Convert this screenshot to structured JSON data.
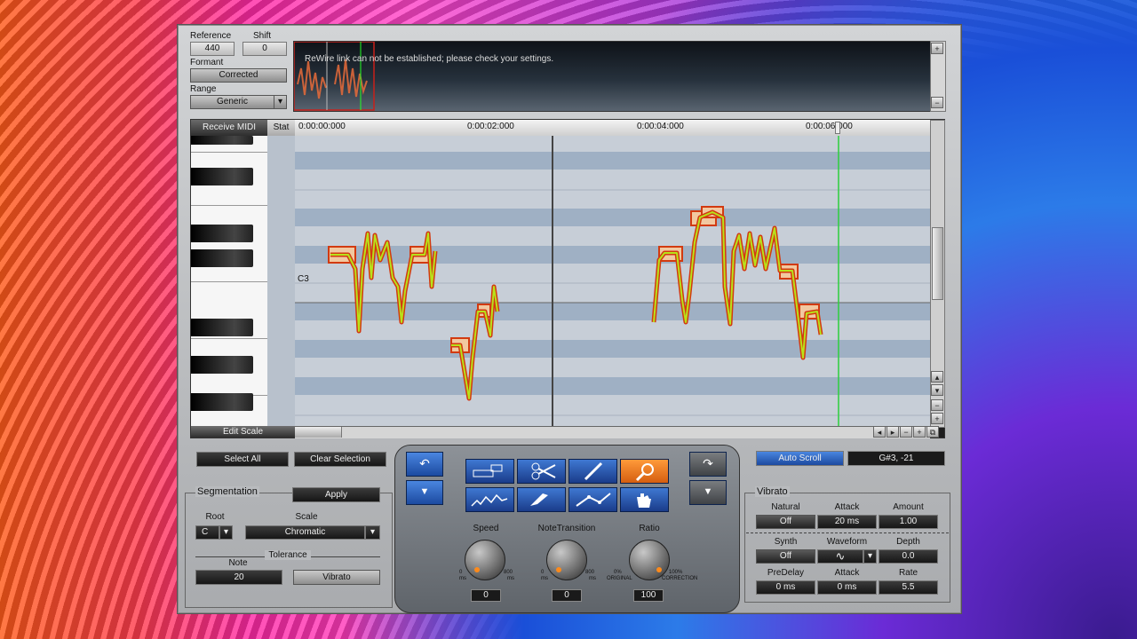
{
  "top": {
    "reference_label": "Reference",
    "reference_value": "440",
    "shift_label": "Shift",
    "shift_value": "0",
    "formant_label": "Formant",
    "formant_value": "Corrected",
    "range_label": "Range",
    "range_value": "Generic",
    "rewire_message": "ReWire link can not be established; please check your settings."
  },
  "editor": {
    "receive_midi": "Receive MIDI",
    "stat": "Stat",
    "edit_scale": "Edit Scale",
    "note_label": "C3",
    "time_marks": [
      "0:00:00:000",
      "0:00:02:000",
      "0:00:04:000",
      "0:00:06:000"
    ]
  },
  "actions": {
    "select_all": "Select All",
    "clear_selection": "Clear Selection",
    "auto_scroll": "Auto Scroll",
    "pitch_readout": "G#3, -21"
  },
  "segmentation": {
    "title": "Segmentation",
    "apply": "Apply",
    "root_label": "Root",
    "root_value": "C",
    "scale_label": "Scale",
    "scale_value": "Chromatic",
    "tolerance_label": "Tolerance",
    "note_label": "Note",
    "note_value": "20",
    "vibrato_button": "Vibrato"
  },
  "correction": {
    "speed_label": "Speed",
    "speed_min": "0",
    "speed_max": "800",
    "speed_unit": "ms",
    "speed_value": "0",
    "transition_label": "NoteTransition",
    "transition_min": "0",
    "transition_max": "800",
    "transition_unit": "ms",
    "transition_value": "0",
    "ratio_label": "Ratio",
    "ratio_min": "0%",
    "ratio_min_sub": "ORIGINAL",
    "ratio_max": "100%",
    "ratio_max_sub": "CORRECTION",
    "ratio_value": "100"
  },
  "vibrato": {
    "title": "Vibrato",
    "natural_label": "Natural",
    "natural_value": "Off",
    "attack_label": "Attack",
    "attack_value": "20 ms",
    "amount_label": "Amount",
    "amount_value": "1.00",
    "synth_label": "Synth",
    "synth_value": "Off",
    "waveform_label": "Waveform",
    "waveform_value": "∿",
    "depth_label": "Depth",
    "depth_value": "0.0",
    "predelay_label": "PreDelay",
    "predelay_value": "0 ms",
    "attack2_label": "Attack",
    "attack2_value": "0 ms",
    "rate_label": "Rate",
    "rate_value": "5.5"
  },
  "icons": {
    "undo": "undo-icon",
    "redo": "redo-icon"
  }
}
